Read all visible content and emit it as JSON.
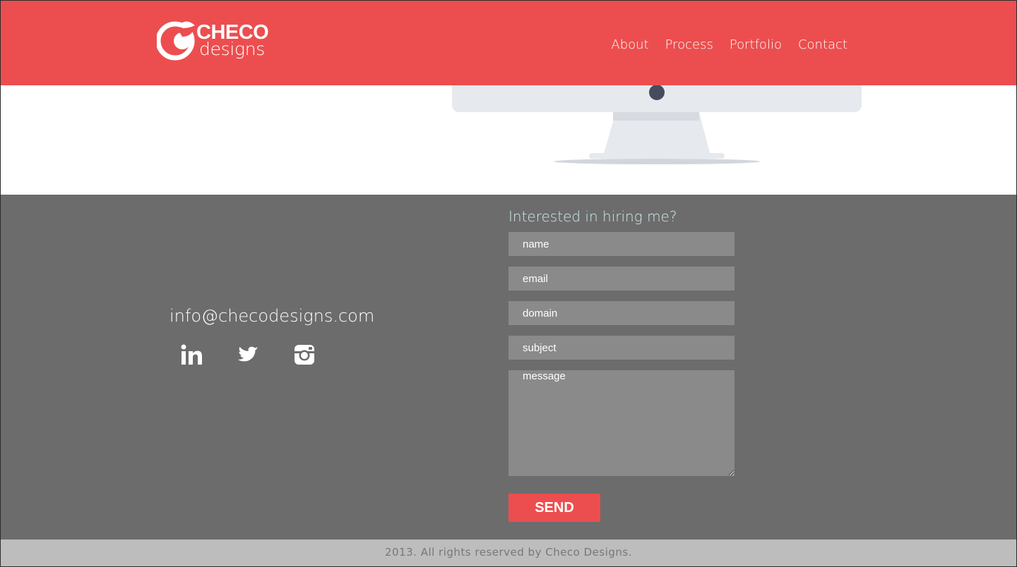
{
  "header": {
    "logo_top": "CHECO",
    "logo_bottom": "designs",
    "nav": [
      {
        "label": "About"
      },
      {
        "label": "Process"
      },
      {
        "label": "Portfolio"
      },
      {
        "label": "Contact"
      }
    ]
  },
  "contact": {
    "email": "info@checodesigns.com",
    "socials": [
      {
        "icon": "linkedin-icon"
      },
      {
        "icon": "twitter-icon"
      },
      {
        "icon": "instagram-icon"
      }
    ],
    "form": {
      "title": "Interested in hiring me?",
      "name_placeholder": "name",
      "email_placeholder": "email",
      "domain_placeholder": "domain",
      "subject_placeholder": "subject",
      "message_placeholder": "message",
      "send_label": "SEND"
    }
  },
  "footer": {
    "copyright": "2013. All rights reserved by Checo Designs."
  },
  "colors": {
    "brand_red": "#ec4e4f",
    "contact_bg": "#6c6c6c",
    "input_bg": "#8a8a8a",
    "footer_bg": "#bdbdbd",
    "title_tint": "#cfe8ea"
  }
}
